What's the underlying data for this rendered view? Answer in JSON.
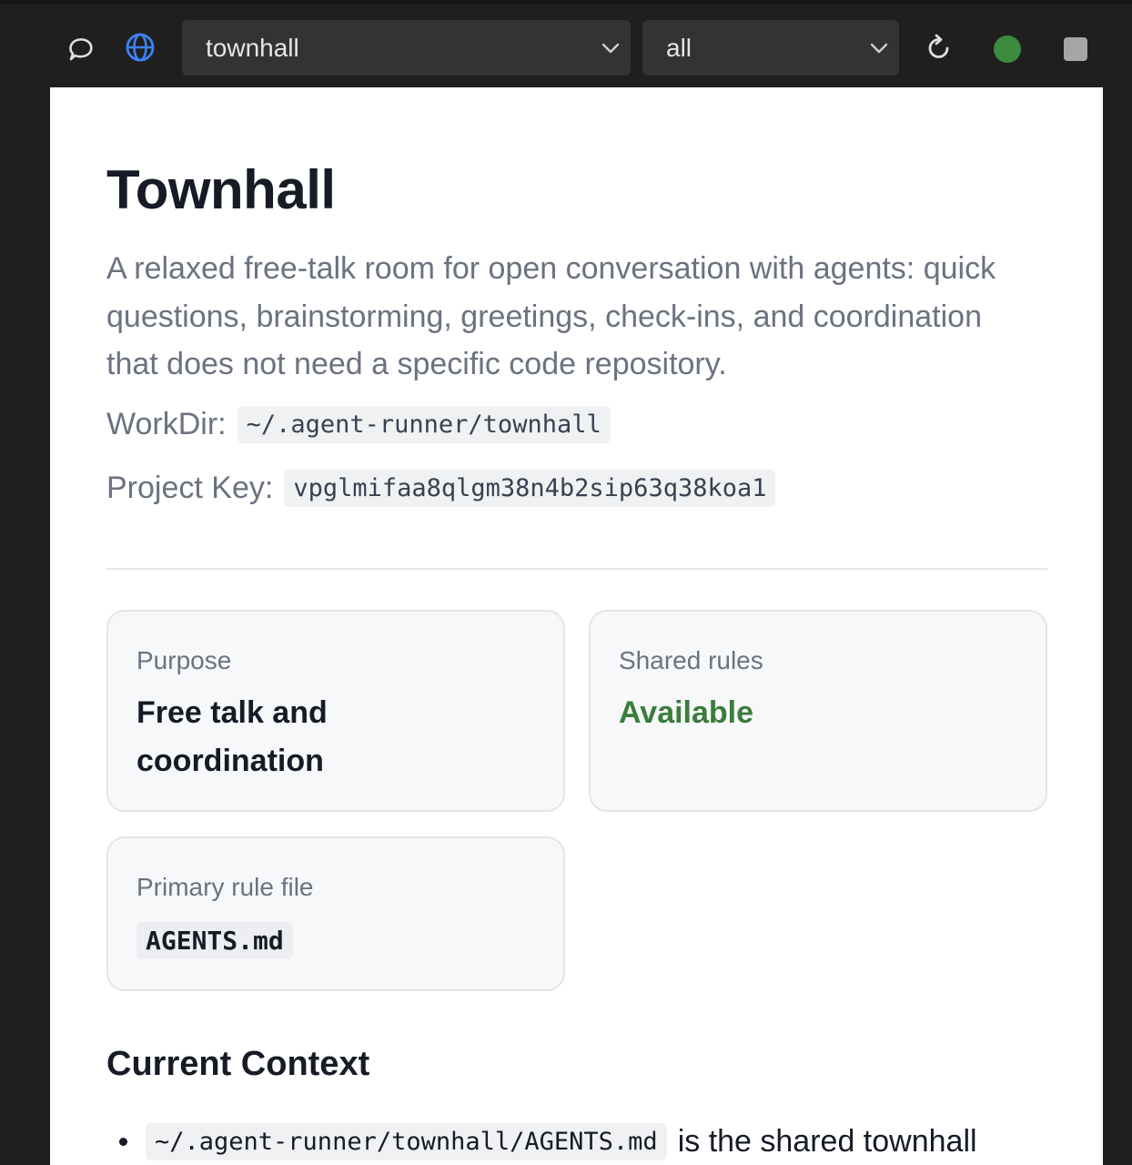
{
  "toolbar": {
    "icons": {
      "chat": "chat-bubble-icon",
      "globe": "globe-icon",
      "refresh": "refresh-icon",
      "chevron": "chevron-down-icon"
    },
    "project_select": {
      "value": "townhall"
    },
    "filter_select": {
      "value": "all"
    },
    "status_color": "#3c8a3e",
    "globe_color": "#3b82f6"
  },
  "page": {
    "title": "Townhall",
    "description": "A relaxed free-talk room for open conversation with agents: quick questions, brainstorming, greetings, check-ins, and coordination that does not need a specific code repository.",
    "workdir_label": "WorkDir:",
    "workdir_value": "~/.agent-runner/townhall",
    "project_key_label": "Project Key:",
    "project_key_value": "vpglmifaa8qlgm38n4b2sip63q38koa1"
  },
  "cards": {
    "purpose": {
      "label": "Purpose",
      "value": "Free talk and coordination"
    },
    "shared_rules": {
      "label": "Shared rules",
      "value": "Available",
      "value_color": "#3a7d3c"
    },
    "primary_rule_file": {
      "label": "Primary rule file",
      "value": "AGENTS.md"
    }
  },
  "current_context": {
    "heading": "Current Context",
    "items": [
      {
        "code": "~/.agent-runner/townhall/AGENTS.md",
        "text": "is the shared townhall"
      }
    ]
  }
}
